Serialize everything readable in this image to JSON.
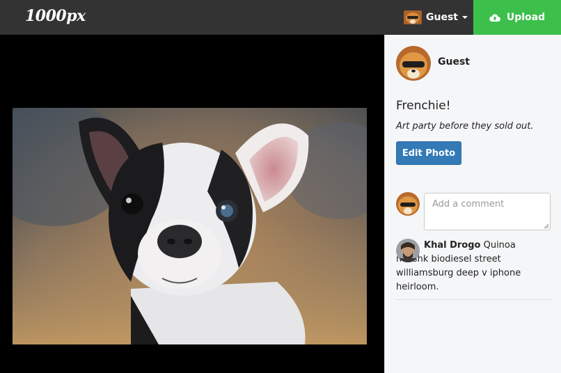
{
  "navbar": {
    "brand": "1000px",
    "user_label": "Guest",
    "upload_label": "Upload",
    "colors": {
      "bar": "#333333",
      "upload": "#3dbf4b"
    }
  },
  "photo": {
    "subject": "french bulldog puppy"
  },
  "sidebar": {
    "owner_name": "Guest",
    "title": "Frenchie!",
    "description": "Art party before they sold out.",
    "edit_label": "Edit Photo",
    "comment_placeholder": "Add a comment",
    "comments": [
      {
        "author": "Khal Drogo",
        "text": "Quinoa mlkshk biodiesel street williamsburg deep v iphone heirloom."
      }
    ]
  }
}
